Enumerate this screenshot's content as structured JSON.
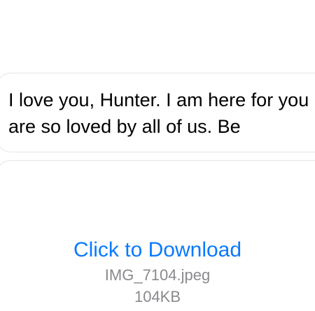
{
  "message": {
    "text_line1": "I love you, Hunter. I am here for you",
    "text_line2": "are so loved by all of us. Be"
  },
  "attachment": {
    "link_label": "Click to Download",
    "file_name": "IMG_7104.jpeg",
    "file_size": "104KB"
  },
  "colors": {
    "link": "#0a7aff",
    "meta_text": "#8a8a8e",
    "bubble_border": "#e4e4e6"
  }
}
